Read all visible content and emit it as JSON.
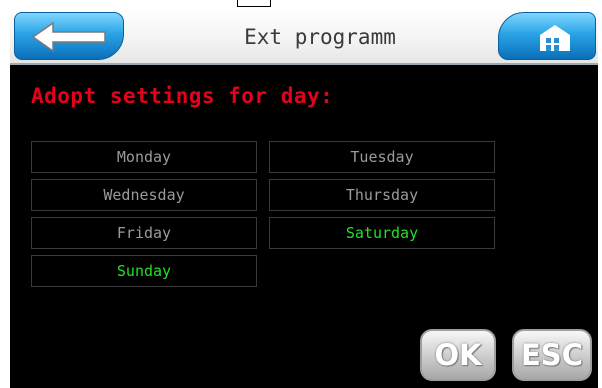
{
  "header": {
    "title": "Ext programm",
    "back_icon": "arrow-left-icon",
    "home_icon": "home-icon"
  },
  "heading": "Adopt settings for day:",
  "days": [
    {
      "label": "Monday",
      "active": false
    },
    {
      "label": "Tuesday",
      "active": false
    },
    {
      "label": "Wednesday",
      "active": false
    },
    {
      "label": "Thursday",
      "active": false
    },
    {
      "label": "Friday",
      "active": false
    },
    {
      "label": "Saturday",
      "active": true
    },
    {
      "label": "Sunday",
      "active": true
    }
  ],
  "actions": {
    "ok_label": "OK",
    "esc_label": "ESC"
  },
  "colors": {
    "heading": "#e6001a",
    "active_day": "#22e022",
    "inactive_day": "#9a9a9a",
    "header_button": "#2aa4e6"
  }
}
